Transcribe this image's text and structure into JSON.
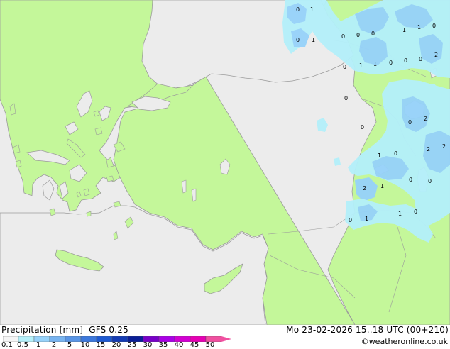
{
  "header": {
    "title": "Precipitation [mm]",
    "model": "GFS 0.25"
  },
  "run": {
    "datetime": "Mo 23-02-2026 15..18 UTC (00+210)"
  },
  "credit": "©weatheronline.co.uk",
  "legend": {
    "ticks": [
      "0.1",
      "0.5",
      "1",
      "2",
      "5",
      "10",
      "15",
      "20",
      "25",
      "30",
      "35",
      "40",
      "45",
      "50"
    ],
    "colors": [
      "#f5f5f5",
      "#b4f0fa",
      "#96d2fa",
      "#78b4f0",
      "#5a96e6",
      "#3c78dc",
      "#1e5ad2",
      "#143cb4",
      "#0a1e96",
      "#7800c8",
      "#aa00e6",
      "#d200d2",
      "#e600b4",
      "#f050a0"
    ]
  },
  "colors": {
    "land": "#c4f79a",
    "sea": "#ececec",
    "coast": "#9b9b9b",
    "precip_light": "#b4f0fa",
    "precip_medium": "#96d2fa"
  },
  "precip_labels": [
    "0",
    "1",
    "0",
    "1",
    "0",
    "0",
    "0",
    "1",
    "1",
    "0",
    "0",
    "1",
    "1",
    "0",
    "0",
    "2",
    "0",
    "0",
    "0",
    "0",
    "2",
    "2",
    "2",
    "1",
    "0",
    "0",
    "2",
    "1",
    "0",
    "0",
    "1",
    "1",
    "0"
  ]
}
